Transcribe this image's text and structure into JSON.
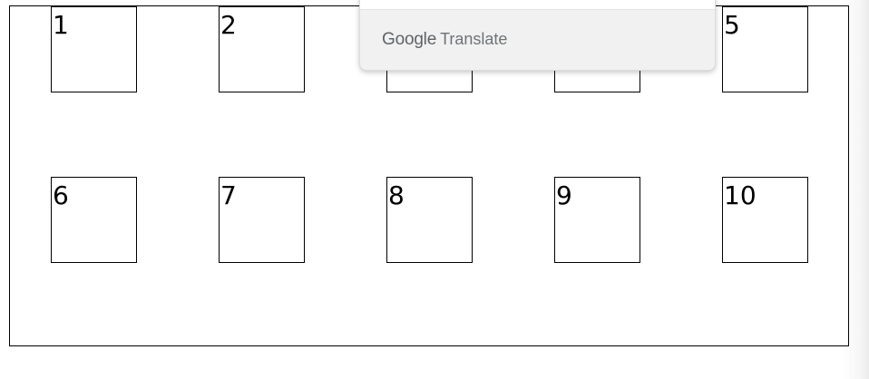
{
  "grid": {
    "boxes": [
      {
        "label": "1"
      },
      {
        "label": "2"
      },
      {
        "label": ""
      },
      {
        "label": ""
      },
      {
        "label": "5"
      },
      {
        "label": "6"
      },
      {
        "label": "7"
      },
      {
        "label": "8"
      },
      {
        "label": "9"
      },
      {
        "label": "10"
      }
    ]
  },
  "translate_popup": {
    "brand_google": "Google",
    "brand_translate": "Translate"
  }
}
